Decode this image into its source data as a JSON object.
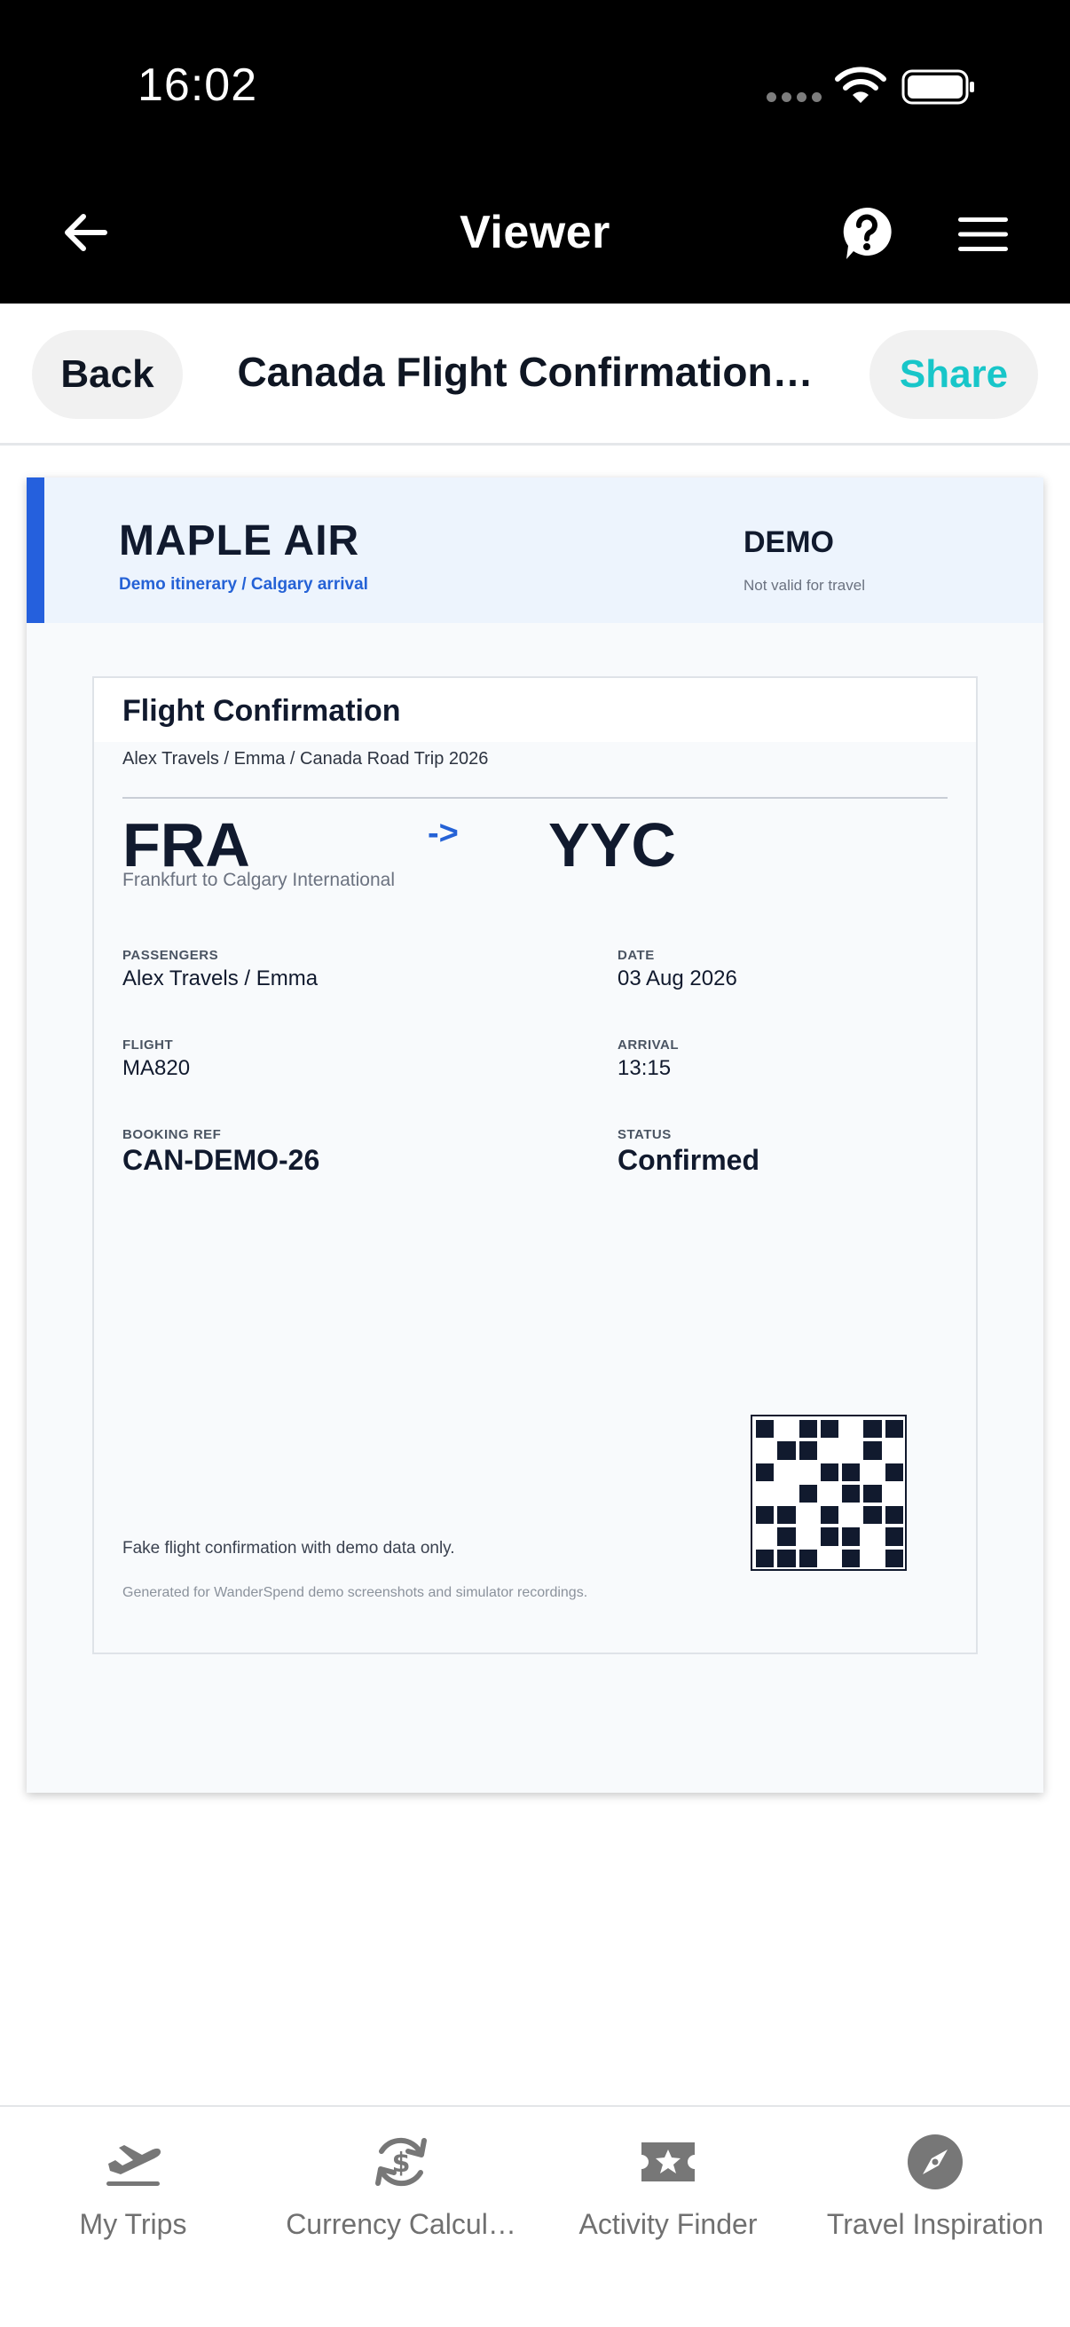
{
  "status_bar": {
    "time": "16:02"
  },
  "nav": {
    "title": "Viewer"
  },
  "toolbar": {
    "back_label": "Back",
    "doc_title": "Canada Flight Confirmation…",
    "share_label": "Share",
    "share_color": "#18c6c9"
  },
  "document": {
    "airline": "MAPLE AIR",
    "airline_sub": "Demo itinerary / Calgary arrival",
    "badge": "DEMO",
    "badge_note": "Not valid for travel",
    "accent_color": "#2560dd",
    "card_title": "Flight Confirmation",
    "card_sub": "Alex Travels / Emma / Canada Road Trip 2026",
    "from": "FRA",
    "to": "YYC",
    "arrow": "->",
    "route_desc": "Frankfurt to Calgary International",
    "fields": {
      "passengers": {
        "label": "PASSENGERS",
        "value": "Alex Travels / Emma"
      },
      "date": {
        "label": "DATE",
        "value": "03 Aug 2026"
      },
      "flight": {
        "label": "FLIGHT",
        "value": "MA820"
      },
      "arrival": {
        "label": "ARRIVAL",
        "value": "13:15"
      },
      "booking_ref": {
        "label": "BOOKING REF",
        "value": "CAN-DEMO-26"
      },
      "status": {
        "label": "STATUS",
        "value": "Confirmed"
      }
    },
    "fine_print_1": "Fake flight confirmation with demo data only.",
    "fine_print_2": "Generated for WanderSpend demo screenshots and simulator recordings."
  },
  "tabs": [
    {
      "label": "My Trips",
      "icon": "plane-takeoff-icon"
    },
    {
      "label": "Currency Calcul…",
      "icon": "currency-exchange-icon"
    },
    {
      "label": "Activity Finder",
      "icon": "ticket-star-icon"
    },
    {
      "label": "Travel Inspiration",
      "icon": "compass-icon"
    }
  ]
}
